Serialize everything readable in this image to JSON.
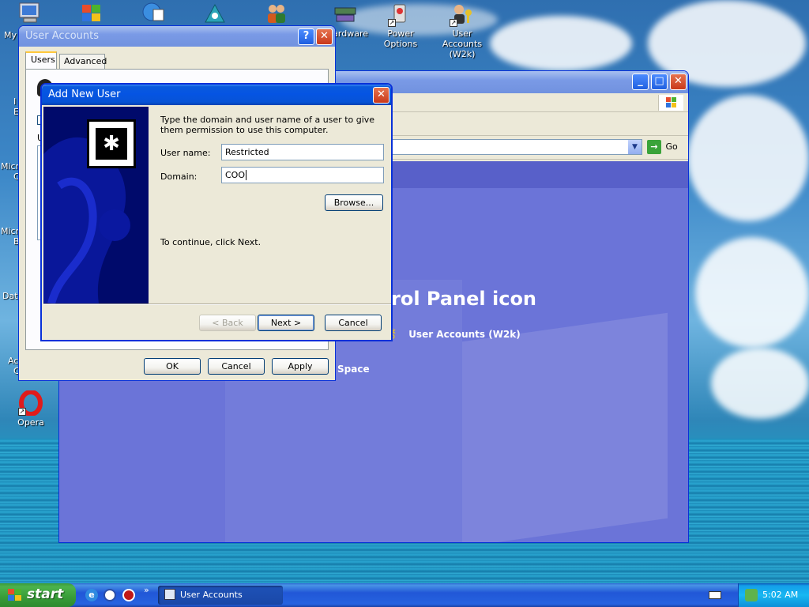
{
  "desktop": {
    "icons": [
      {
        "label": "Hardware"
      },
      {
        "label": "Power Options"
      },
      {
        "label": "User Accounts (W2k)"
      },
      {
        "label": "Opera"
      }
    ],
    "edge_labels": [
      "My",
      "I",
      "E",
      "Micro",
      "C",
      "Micro",
      "B",
      "Data",
      "Ac",
      "C"
    ]
  },
  "control_panel": {
    "go_label": "Go",
    "heading_fragment": "rol Panel icon",
    "user_accounts_link": "User Accounts (W2k)",
    "space_fragment": "Space"
  },
  "user_accounts": {
    "title": "User Accounts",
    "tabs": [
      {
        "label": "Users"
      },
      {
        "label": "Advanced"
      }
    ],
    "buttons": {
      "ok": "OK",
      "cancel": "Cancel",
      "apply": "Apply"
    },
    "side_letter": "U"
  },
  "add_user": {
    "title": "Add New User",
    "instructions": "Type the domain and user name of a user to give them permission to use this computer.",
    "username_label": "User name:",
    "username_value": "Restricted",
    "domain_label": "Domain:",
    "domain_value": "COO",
    "browse_label": "Browse...",
    "continue_text": "To continue, click Next.",
    "back_label": "< Back",
    "next_label": "Next >",
    "cancel_label": "Cancel"
  },
  "taskbar": {
    "start_label": "start",
    "task_item": "User Accounts",
    "clock": "5:02 AM",
    "quicklaunch_more": "»"
  },
  "colors": {
    "title_active": "#0554e3",
    "cp_background": "#6b74d8",
    "start_green": "#3c9b3c",
    "dialog_face": "#ece9d8"
  }
}
